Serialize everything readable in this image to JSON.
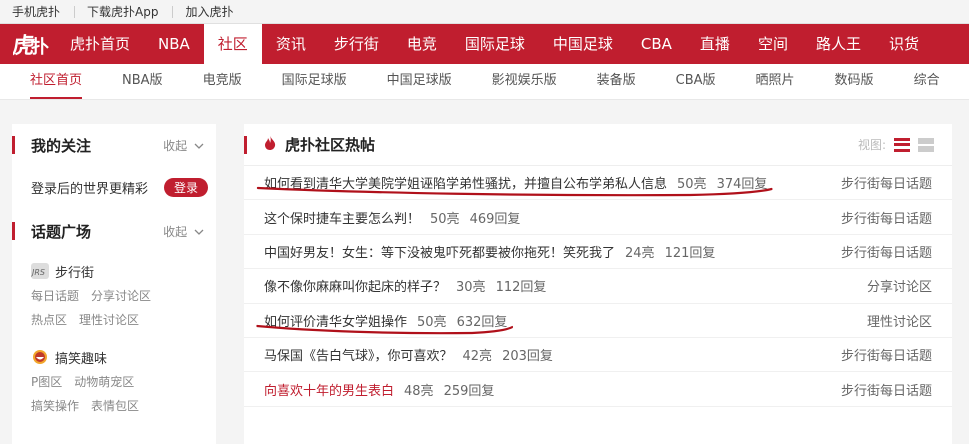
{
  "topbar": {
    "links": [
      "手机虎扑",
      "下载虎扑App",
      "加入虎扑"
    ]
  },
  "logo": "虎扑",
  "mainnav": {
    "items": [
      "虎扑首页",
      "NBA",
      "社区",
      "资讯",
      "步行街",
      "电竞",
      "国际足球",
      "中国足球",
      "CBA",
      "直播",
      "空间",
      "路人王",
      "识货"
    ],
    "active_index": 2
  },
  "subnav": {
    "items": [
      "社区首页",
      "NBA版",
      "电竞版",
      "国际足球版",
      "中国足球版",
      "影视娱乐版",
      "装备版",
      "CBA版",
      "晒照片",
      "数码版",
      "综合"
    ],
    "active_index": 0
  },
  "left": {
    "my_follow_title": "我的关注",
    "collapse_label": "收起",
    "login_hint": "登录后的世界更精彩",
    "login_button": "登录",
    "topic_square_title": "话题广场",
    "groups": [
      {
        "name": "步行街",
        "icon": "jrs-icon",
        "links": [
          "每日话题",
          "分享讨论区",
          "热点区",
          "理性讨论区"
        ]
      },
      {
        "name": "搞笑趣味",
        "icon": "funny-face-icon",
        "links": [
          "P图区",
          "动物萌宠区",
          "搞笑操作",
          "表情包区"
        ]
      }
    ]
  },
  "hot": {
    "title": "虎扑社区热帖",
    "view_label": "视图:",
    "rows": [
      {
        "title": "如何看到清华大学美院学姐诬陷学弟性骚扰，并擅自公布学弟私人信息",
        "likes": "50亮",
        "replies": "374回复",
        "board": "步行街每日话题",
        "underlined": true,
        "red": false
      },
      {
        "title": "这个保时捷车主要怎么判！",
        "likes": "50亮",
        "replies": "469回复",
        "board": "步行街每日话题",
        "underlined": false,
        "red": false
      },
      {
        "title": "中国好男友！女生：等下没被鬼吓死都要被你拖死！笑死我了",
        "likes": "24亮",
        "replies": "121回复",
        "board": "步行街每日话题",
        "underlined": false,
        "red": false
      },
      {
        "title": "像不像你麻麻叫你起床的样子？",
        "likes": "30亮",
        "replies": "112回复",
        "board": "分享讨论区",
        "underlined": false,
        "red": false
      },
      {
        "title": "如何评价清华女学姐操作",
        "likes": "50亮",
        "replies": "632回复",
        "board": "理性讨论区",
        "underlined": true,
        "red": false
      },
      {
        "title": "马保国《告白气球》，你可喜欢？",
        "likes": "42亮",
        "replies": "203回复",
        "board": "步行街每日话题",
        "underlined": false,
        "red": false
      },
      {
        "title": "向喜欢十年的男生表白",
        "likes": "48亮",
        "replies": "259回复",
        "board": "步行街每日话题",
        "underlined": false,
        "red": true
      }
    ]
  },
  "colors": {
    "brand": "#c01e2f"
  }
}
